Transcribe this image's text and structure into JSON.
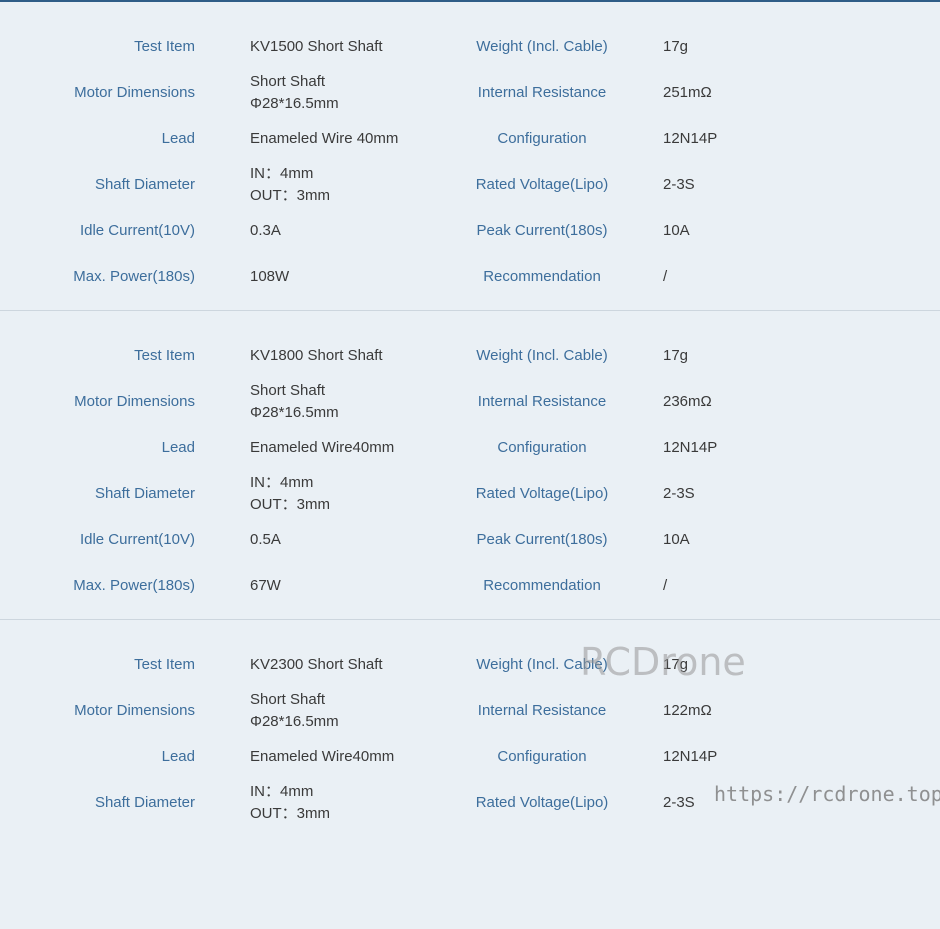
{
  "colors": {
    "background": "#eaf0f5",
    "label": "#3d6e9c",
    "value": "#3a3a3a",
    "divider": "#cdd6de",
    "top_border": "#2f5d87"
  },
  "blocks": [
    {
      "rows": [
        {
          "label1": "Test Item",
          "value1": [
            "KV1500 Short Shaft"
          ],
          "label2": "Weight (Incl. Cable)",
          "value2": "17g"
        },
        {
          "label1": "Motor Dimensions",
          "value1": [
            "Short Shaft",
            "Φ28*16.5mm"
          ],
          "label2": "Internal Resistance",
          "value2": "251mΩ"
        },
        {
          "label1": "Lead",
          "value1": [
            "Enameled Wire 40mm"
          ],
          "label2": "Configuration",
          "value2": "12N14P"
        },
        {
          "label1": "Shaft Diameter",
          "value1": [
            "IN：4mm",
            "OUT：3mm"
          ],
          "label2": "Rated Voltage(Lipo)",
          "value2": "2-3S"
        },
        {
          "label1": "Idle Current(10V)",
          "value1": [
            "0.3A"
          ],
          "label2": "Peak Current(180s)",
          "value2": "10A"
        },
        {
          "label1": "Max. Power(180s)",
          "value1": [
            "108W"
          ],
          "label2": "Recommendation",
          "value2": "/"
        }
      ]
    },
    {
      "rows": [
        {
          "label1": "Test Item",
          "value1": [
            "KV1800 Short Shaft"
          ],
          "label2": "Weight (Incl. Cable)",
          "value2": "17g"
        },
        {
          "label1": "Motor Dimensions",
          "value1": [
            "Short Shaft",
            "Φ28*16.5mm"
          ],
          "label2": "Internal Resistance",
          "value2": "236mΩ"
        },
        {
          "label1": "Lead",
          "value1": [
            "Enameled Wire40mm"
          ],
          "label2": "Configuration",
          "value2": "12N14P"
        },
        {
          "label1": "Shaft Diameter",
          "value1": [
            "IN：4mm",
            "OUT：3mm"
          ],
          "label2": "Rated Voltage(Lipo)",
          "value2": "2-3S"
        },
        {
          "label1": "Idle Current(10V)",
          "value1": [
            "0.5A"
          ],
          "label2": "Peak Current(180s)",
          "value2": "10A"
        },
        {
          "label1": "Max. Power(180s)",
          "value1": [
            "67W"
          ],
          "label2": "Recommendation",
          "value2": "/"
        }
      ]
    },
    {
      "rows": [
        {
          "label1": "Test Item",
          "value1": [
            "KV2300 Short Shaft"
          ],
          "label2": "Weight (Incl. Cable)",
          "value2": "17g"
        },
        {
          "label1": "Motor Dimensions",
          "value1": [
            "Short Shaft",
            "Φ28*16.5mm"
          ],
          "label2": "Internal Resistance",
          "value2": "122mΩ"
        },
        {
          "label1": "Lead",
          "value1": [
            "Enameled Wire40mm"
          ],
          "label2": "Configuration",
          "value2": "12N14P"
        },
        {
          "label1": "Shaft Diameter",
          "value1": [
            "IN：4mm",
            "OUT：3mm"
          ],
          "label2": "Rated Voltage(Lipo)",
          "value2": "2-3S"
        }
      ]
    }
  ],
  "watermark": {
    "text": "RCDrone",
    "url": "https://rcdrone.top/"
  }
}
